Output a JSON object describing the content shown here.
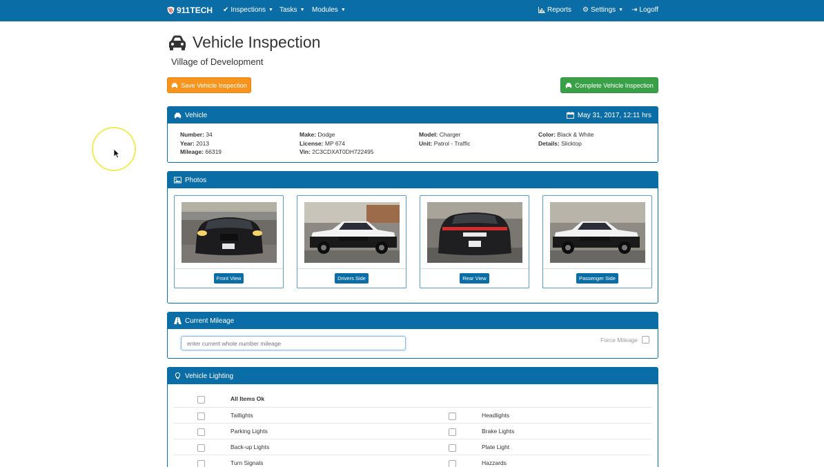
{
  "nav": {
    "brand": "911TECH",
    "inspections": "Inspections",
    "tasks": "Tasks",
    "modules": "Modules",
    "reports": "Reports",
    "settings": "Settings",
    "logoff": "Logoff"
  },
  "header": {
    "title": "Vehicle Inspection",
    "subtitle": "Village of Development"
  },
  "actions": {
    "save": "Save Vehicle Inspection",
    "complete": "Complete Vehicle Inspection"
  },
  "vehicle": {
    "heading": "Vehicle",
    "date": "May 31, 2017, 12:11 hrs",
    "number_label": "Number:",
    "number": "34",
    "year_label": "Year:",
    "year": "2013",
    "mileage_label": "Mileage:",
    "mileage": "66319",
    "make_label": "Make:",
    "make": "Dodge",
    "license_label": "License:",
    "license": "MP 674",
    "vin_label": "Vin:",
    "vin": "2C3CDXAT0DH722495",
    "model_label": "Model:",
    "model": "Charger",
    "unit_label": "Unit:",
    "unit": "Patrol - Traffic",
    "color_label": "Color:",
    "color": "Black & White",
    "details_label": "Details:",
    "details": "Slicktop"
  },
  "photos": {
    "heading": "Photos",
    "items": [
      {
        "label": "Front View"
      },
      {
        "label": "Drivers Side"
      },
      {
        "label": "Rear View"
      },
      {
        "label": "Passenger Side"
      }
    ]
  },
  "mileage": {
    "heading": "Current Mileage",
    "placeholder": "enter current whole number mileage",
    "force_label": "Force Mileage"
  },
  "lighting": {
    "heading": "Vehicle Lighting",
    "all_ok": "All Items Ok",
    "rows": [
      {
        "left": "Taillights",
        "right": "Headlights"
      },
      {
        "left": "Parking Lights",
        "right": "Brake Lights"
      },
      {
        "left": "Back-up Lights",
        "right": "Plate Light"
      },
      {
        "left": "Turn Signals",
        "right": "Hazzards"
      }
    ]
  },
  "colors": {
    "primary": "#0b6da5",
    "orange": "#f7941d",
    "green": "#3aa048"
  },
  "icons": [
    "shield-icon",
    "check-icon",
    "bar-chart-icon",
    "gears-icon",
    "sign-out-icon",
    "car-icon",
    "calendar-icon",
    "image-icon",
    "road-icon",
    "lightbulb-icon"
  ]
}
